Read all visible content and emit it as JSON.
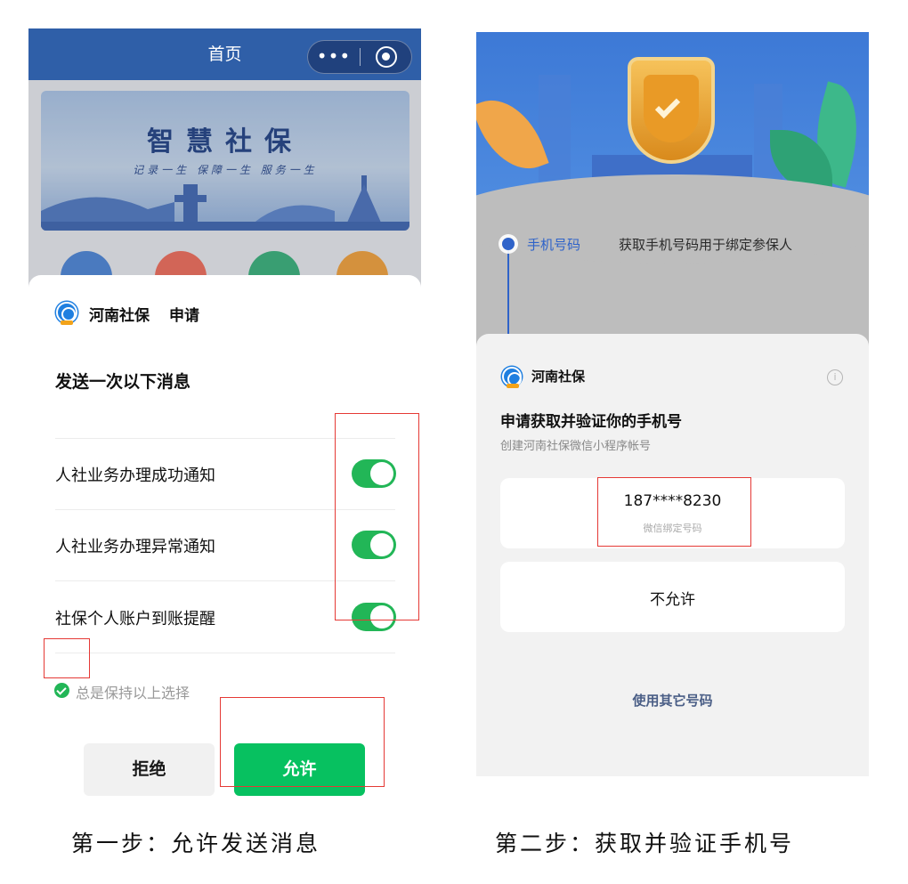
{
  "left_screen": {
    "nav_title": "首页",
    "capsule": {
      "more_icon": "•••",
      "close_icon": "target-icon"
    },
    "banner": {
      "title": "智慧社保",
      "subtitle": "记录一生 保障一生 服务一生"
    },
    "sheet": {
      "app_name": "河南社保",
      "action": "申请",
      "section_title": "发送一次以下消息",
      "items": [
        {
          "label": "人社业务办理成功通知",
          "enabled": true
        },
        {
          "label": "人社业务办理异常通知",
          "enabled": true
        },
        {
          "label": "社保个人账户到账提醒",
          "enabled": true
        }
      ],
      "keep_choice": {
        "label": "总是保持以上选择",
        "checked": true
      },
      "reject_label": "拒绝",
      "allow_label": "允许"
    }
  },
  "right_screen": {
    "step": {
      "label": "手机号码",
      "description": "获取手机号码用于绑定参保人"
    },
    "sheet": {
      "app_name": "河南社保",
      "title": "申请获取并验证你的手机号",
      "subtitle": "创建河南社保微信小程序帐号",
      "phone": "187****8230",
      "phone_caption": "微信绑定号码",
      "deny_label": "不允许",
      "other_label": "使用其它号码"
    }
  },
  "captions": {
    "left": "第一步：允许发送消息",
    "right": "第二步：获取并验证手机号"
  },
  "colors": {
    "primary_blue": "#2f5fa8",
    "wechat_green": "#07c160",
    "toggle_green": "#22b657",
    "highlight_red": "#e53935"
  }
}
